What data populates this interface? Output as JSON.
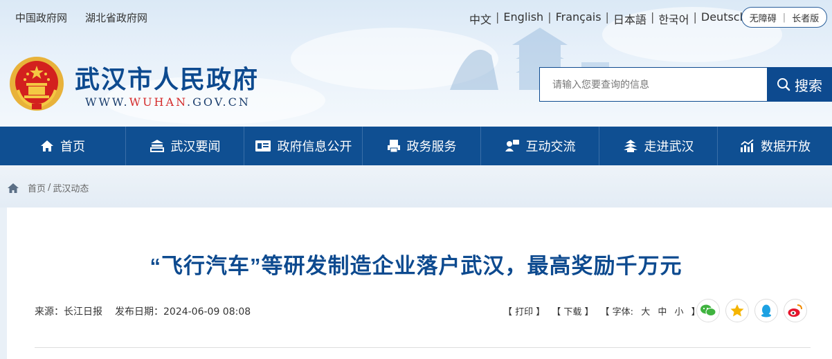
{
  "top_links": [
    "中国政府网",
    "湖北省政府网"
  ],
  "languages": [
    "中文",
    "English",
    "Français",
    "日本語",
    "한국어",
    "Deutsch"
  ],
  "accessibility": {
    "barrier_free": "无障碍",
    "elder": "长者版"
  },
  "site": {
    "title": "武汉市人民政府",
    "url_prefix": "WWW.",
    "url_highlight": "WUHAN",
    "url_suffix": ".GOV.CN"
  },
  "search": {
    "placeholder": "请输入您要查询的信息",
    "button": "搜索"
  },
  "nav": [
    {
      "label": "首页",
      "icon": "home-icon"
    },
    {
      "label": "武汉要闻",
      "icon": "news-tray-icon"
    },
    {
      "label": "政府信息公开",
      "icon": "info-board-icon"
    },
    {
      "label": "政务服务",
      "icon": "printer-service-icon"
    },
    {
      "label": "互动交流",
      "icon": "interaction-icon"
    },
    {
      "label": "走进武汉",
      "icon": "tower-icon"
    },
    {
      "label": "数据开放",
      "icon": "chart-icon"
    }
  ],
  "breadcrumb": {
    "home": "首页",
    "sep": "/",
    "section": "武汉动态"
  },
  "article": {
    "title": "“飞行汽车”等研发制造企业落户武汉，最高奖励千万元",
    "source": "来源：长江日报",
    "date": "发布日期：2024-06-09 08:08"
  },
  "tools": {
    "print": "【 打印 】",
    "download": "【 下载 】",
    "font_label": "【 字体:",
    "font_large": "大",
    "font_medium": "中",
    "font_small": "小",
    "font_close": "】"
  },
  "share_icons": [
    "wechat-icon",
    "qzone-icon",
    "qq-icon",
    "weibo-icon"
  ],
  "colors": {
    "brand_blue": "#0d4a8f",
    "nav_blue": "#0f4f92",
    "url_red": "#d42a2a"
  }
}
